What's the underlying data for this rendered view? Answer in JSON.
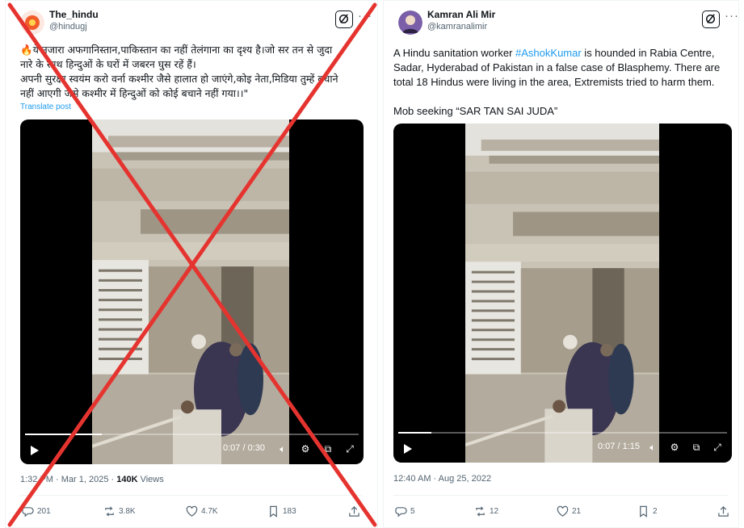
{
  "left_post": {
    "author_name": "The_hindu",
    "author_handle": "@hindugj",
    "text_line1": "🔥ये नजारा अफगानिस्तान,पाकिस्तान का नहीं तेलंगाना का दृश्य है।जो सर तन से जुदा",
    "text_line2": "नारे के साथ हिन्दुओं के घरों में जबरन घुस रहें हैं।",
    "text_line3": "अपनी सुरक्षा स्वयंम करो वर्ना कश्मीर जैसे हालात हो जाएंगे,कोइ नेता,मिडिया तुम्हें बचाने",
    "text_line4": "नहीं आएगी जैसे कश्मीर में हिन्दुओं को कोई बचाने नहीं गया।।\"",
    "translate_label": "Translate post",
    "video_time": "0:07 / 0:30",
    "video_progress": 0.23,
    "timestamp": "1:32 PM · Mar 1, 2025 · ",
    "views_count": "140K",
    "views_label": " Views",
    "replies": "201",
    "reposts": "3.8K",
    "likes": "4.7K",
    "bookmarks": "183",
    "cross_color": "#e5342f"
  },
  "right_post": {
    "author_name": "Kamran Ali Mir",
    "author_handle": "@kamranalimir",
    "text_part1": "A Hindu sanitation worker ",
    "hashtag": "#AshokKumar",
    "text_part2": " is hounded in Rabia Centre,",
    "text_line2": "Sadar, Hyderabad of Pakistan in a false case of Blasphemy. There are",
    "text_line3": "total 18 Hindus were living in the area, Extremists tried to harm them.",
    "text_line4": "Mob seeking “SAR TAN SAI JUDA”",
    "video_time": "0:07 / 1:15",
    "video_progress": 0.1,
    "timestamp": "12:40 AM · Aug 25, 2022",
    "replies": "5",
    "reposts": "12",
    "likes": "21",
    "bookmarks": "2"
  },
  "icons": [
    "grok-icon",
    "more-icon",
    "play-icon",
    "volume-icon",
    "settings-icon",
    "pip-icon",
    "fullscreen-icon",
    "reply-icon",
    "repost-icon",
    "like-icon",
    "bookmark-icon",
    "share-icon"
  ],
  "colors": {
    "link": "#1d9bf0",
    "secondary_text": "#536471",
    "cross": "#e5342f"
  }
}
